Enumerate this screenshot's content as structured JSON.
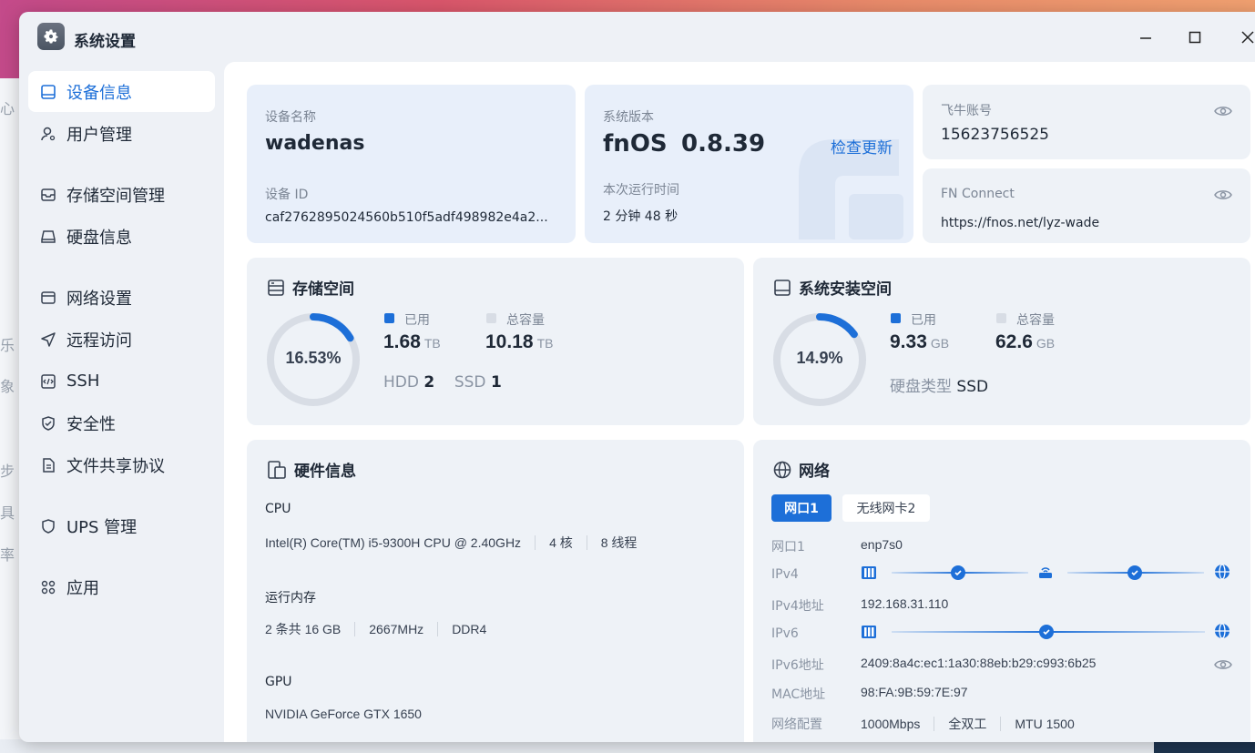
{
  "window": {
    "title": "系统设置"
  },
  "background_fragments": [
    "心",
    "乐",
    "象",
    "步",
    "具",
    "率"
  ],
  "sidebar": {
    "items": [
      {
        "label": "设备信息",
        "icon": "monitor-icon",
        "active": true
      },
      {
        "label": "用户管理",
        "icon": "user-icon"
      },
      {
        "label": "存储空间管理",
        "icon": "storage-icon"
      },
      {
        "label": "硬盘信息",
        "icon": "disk-icon"
      },
      {
        "label": "网络设置",
        "icon": "network-icon"
      },
      {
        "label": "远程访问",
        "icon": "remote-icon"
      },
      {
        "label": "SSH",
        "icon": "ssh-icon"
      },
      {
        "label": "安全性",
        "icon": "shield-check-icon"
      },
      {
        "label": "文件共享协议",
        "icon": "file-icon"
      },
      {
        "label": "UPS 管理",
        "icon": "shield-icon"
      },
      {
        "label": "应用",
        "icon": "apps-icon"
      }
    ]
  },
  "device": {
    "name_label": "设备名称",
    "name": "wadenas",
    "id_label": "设备 ID",
    "id": "caf276289502456 0b510f5adf498982e4a2..."
  },
  "system": {
    "version_label": "系统版本",
    "os": "fnOS",
    "version": "0.8.39",
    "check_update": "检查更新",
    "uptime_label": "本次运行时间",
    "uptime": "2 分钟 48 秒"
  },
  "account": {
    "label": "飞牛账号",
    "value": "15623756525"
  },
  "fn_connect": {
    "label": "FN Connect",
    "value": "https://fnos.net/lyz-wade"
  },
  "storage": {
    "title": "存储空间",
    "percent": "16.53%",
    "percent_value": 16.53,
    "used_label": "已用",
    "used": "1.68",
    "used_unit": "TB",
    "total_label": "总容量",
    "total": "10.18",
    "total_unit": "TB",
    "hdd_label": "HDD",
    "hdd": "2",
    "ssd_label": "SSD",
    "ssd": "1"
  },
  "sys_storage": {
    "title": "系统安装空间",
    "percent": "14.9%",
    "percent_value": 14.9,
    "used_label": "已用",
    "used": "9.33",
    "used_unit": "GB",
    "total_label": "总容量",
    "total": "62.6",
    "total_unit": "GB",
    "disk_type_label": "硬盘类型",
    "disk_type": "SSD"
  },
  "hardware": {
    "title": "硬件信息",
    "cpu_label": "CPU",
    "cpu_model": "Intel(R) Core(TM) i5-9300H CPU @ 2.40GHz",
    "cpu_cores": "4 核",
    "cpu_threads": "8 线程",
    "mem_label": "运行内存",
    "mem_size": "2 条共 16 GB",
    "mem_speed": "2667MHz",
    "mem_type": "DDR4",
    "gpu_label": "GPU",
    "gpu_model": "NVIDIA GeForce GTX 1650"
  },
  "network": {
    "title": "网络",
    "tabs": [
      "网口1",
      "无线网卡2"
    ],
    "rows": {
      "port_label": "网口1",
      "port": "enp7s0",
      "ipv4_label": "IPv4",
      "ipv4_addr_label": "IPv4地址",
      "ipv4_addr": "192.168.31.110",
      "ipv6_label": "IPv6",
      "ipv6_addr_label": "IPv6地址",
      "ipv6_addr": "2409:8a4c:ec1:1a30:88eb:b29:c993:6b25",
      "mac_label": "MAC地址",
      "mac": "98:FA:9B:59:7E:97",
      "config_label": "网络配置",
      "speed": "1000Mbps",
      "duplex": "全双工",
      "mtu": "MTU 1500"
    }
  },
  "colors": {
    "accent": "#1d6fd8",
    "track": "#d8dde5"
  }
}
